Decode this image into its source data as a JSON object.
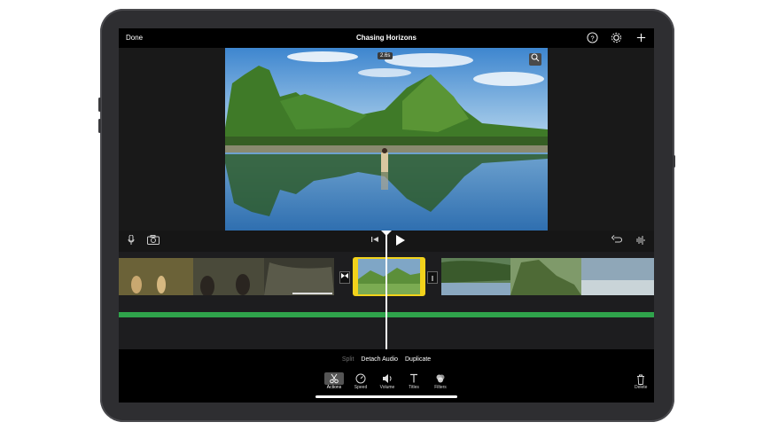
{
  "topbar": {
    "done_label": "Done",
    "title": "Chasing Horizons",
    "help_icon": "question-circle-icon",
    "settings_icon": "gear-icon",
    "add_icon": "plus-icon"
  },
  "viewer": {
    "timecode": "2.6s",
    "zoom_icon": "magnifier-icon"
  },
  "controls": {
    "mic_icon": "microphone-icon",
    "camera_icon": "camera-icon",
    "skip_back_icon": "skip-to-start-icon",
    "play_icon": "play-icon",
    "undo_icon": "undo-icon",
    "waveform_icon": "waveform-icon"
  },
  "actions": {
    "split": "Split",
    "detach_audio": "Detach Audio",
    "duplicate": "Duplicate"
  },
  "tools": [
    {
      "label": "Actions",
      "icon": "scissors-icon"
    },
    {
      "label": "Speed",
      "icon": "speedometer-icon"
    },
    {
      "label": "Volume",
      "icon": "speaker-icon"
    },
    {
      "label": "Titles",
      "icon": "text-t-icon"
    },
    {
      "label": "Filters",
      "icon": "filters-circles-icon"
    }
  ],
  "delete_label": "Delete",
  "colors": {
    "selection": "#f2d21b",
    "audio_track": "#2fa34b"
  }
}
